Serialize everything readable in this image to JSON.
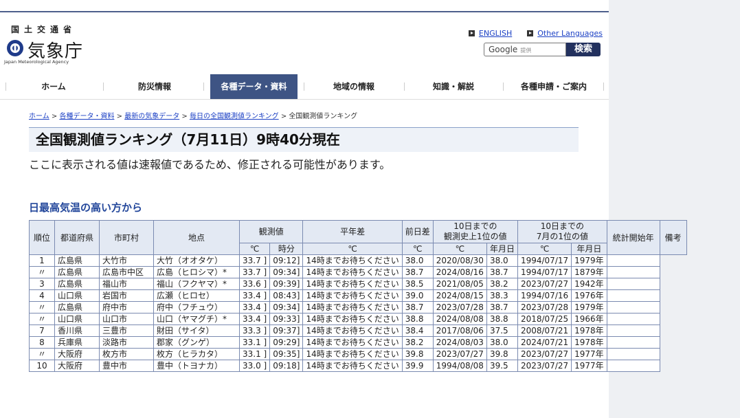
{
  "header": {
    "logo_ja": "国土交通省",
    "logo_name": "気象庁",
    "logo_en": "Japan Meteorological Agency",
    "lang_links": [
      "ENGLISH",
      "Other Languages"
    ],
    "search": {
      "value": "Google",
      "sub": "提供",
      "button": "検索"
    }
  },
  "nav": [
    "ホーム",
    "防災情報",
    "各種データ・資料",
    "地域の情報",
    "知識・解説",
    "各種申請・ご案内"
  ],
  "breadcrumb": {
    "links": [
      "ホーム",
      "各種データ・資料",
      "最新の気象データ",
      "毎日の全国観測値ランキング"
    ],
    "current": "全国観測値ランキング",
    "sep": " > "
  },
  "page": {
    "title": "全国観測値ランキング（7月11日）9時40分現在",
    "notice": "ここに表示される値は速報値であるため、修正される可能性があります。",
    "section": "日最高気温の高い方から"
  },
  "table": {
    "h_rank": "順位",
    "h_pref": "都道府県",
    "h_city": "市町村",
    "h_point": "地点",
    "h_obs": "観測値",
    "h_norm": "平年差",
    "h_prev": "前日差",
    "h_hist_top": "10日までの",
    "h_hist_bot": "観測史上1位の値",
    "h_july_top": "10日までの",
    "h_july_bot": "7月の1位の値",
    "h_start": "統計開始年",
    "h_note": "備考",
    "s_deg": "℃",
    "s_time": "時分",
    "s_ymd": "年月日",
    "rows": [
      [
        "1",
        "広島県",
        "大竹市",
        "大竹（オオタケ）",
        "33.7 ]",
        "09:12]",
        "14時までお待ちください",
        "38.0",
        "2020/08/30",
        "38.0",
        "1994/07/17",
        "1979年",
        ""
      ],
      [
        "〃",
        "広島県",
        "広島市中区",
        "広島（ヒロシマ）*",
        "33.7 ]",
        "09:34]",
        "14時までお待ちください",
        "38.7",
        "2024/08/16",
        "38.7",
        "1994/07/17",
        "1879年",
        ""
      ],
      [
        "3",
        "広島県",
        "福山市",
        "福山（フクヤマ）*",
        "33.6 ]",
        "09:39]",
        "14時までお待ちください",
        "38.5",
        "2021/08/05",
        "38.2",
        "2023/07/27",
        "1942年",
        ""
      ],
      [
        "4",
        "山口県",
        "岩国市",
        "広瀬（ヒロセ）",
        "33.4 ]",
        "08:43]",
        "14時までお待ちください",
        "39.0",
        "2024/08/15",
        "38.3",
        "1994/07/16",
        "1976年",
        ""
      ],
      [
        "〃",
        "広島県",
        "府中市",
        "府中（フチュウ）",
        "33.4 ]",
        "09:34]",
        "14時までお待ちください",
        "38.7",
        "2023/07/28",
        "38.7",
        "2023/07/28",
        "1979年",
        ""
      ],
      [
        "〃",
        "山口県",
        "山口市",
        "山口（ヤマグチ）*",
        "33.4 ]",
        "09:33]",
        "14時までお待ちください",
        "38.8",
        "2024/08/08",
        "38.8",
        "2018/07/25",
        "1966年",
        ""
      ],
      [
        "7",
        "香川県",
        "三豊市",
        "財田（サイタ）",
        "33.3 ]",
        "09:37]",
        "14時までお待ちください",
        "38.4",
        "2017/08/06",
        "37.5",
        "2008/07/21",
        "1978年",
        ""
      ],
      [
        "8",
        "兵庫県",
        "淡路市",
        "郡家（グンゲ）",
        "33.1 ]",
        "09:29]",
        "14時までお待ちください",
        "38.2",
        "2024/08/03",
        "38.0",
        "2024/07/21",
        "1978年",
        ""
      ],
      [
        "〃",
        "大阪府",
        "枚方市",
        "枚方（ヒラカタ）",
        "33.1 ]",
        "09:35]",
        "14時までお待ちください",
        "39.8",
        "2023/07/27",
        "39.8",
        "2023/07/27",
        "1977年",
        ""
      ],
      [
        "10",
        "大阪府",
        "豊中市",
        "豊中（トヨナカ）",
        "33.0 ]",
        "09:18]",
        "14時までお待ちください",
        "39.9",
        "1994/08/08",
        "39.5",
        "2023/07/27",
        "1977年",
        ""
      ]
    ]
  }
}
